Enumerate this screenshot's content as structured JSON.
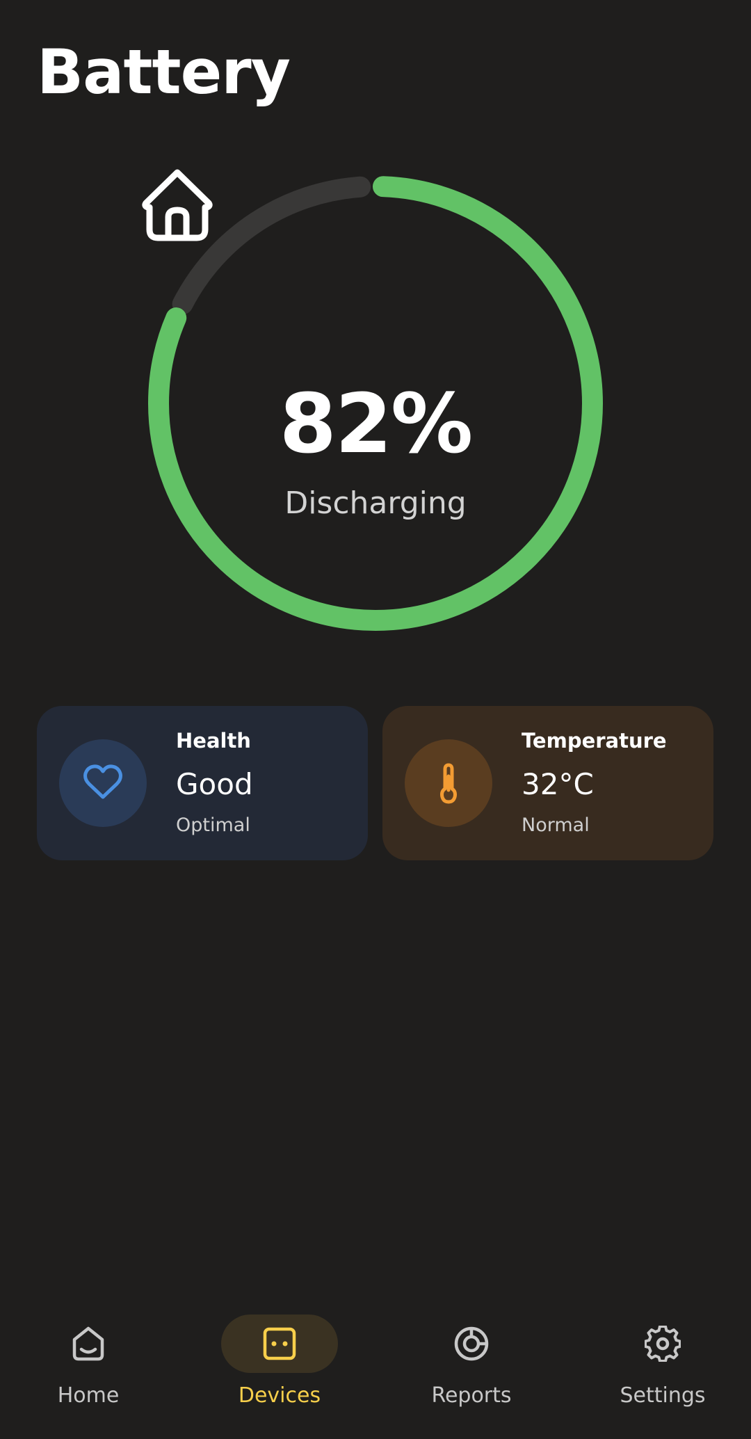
{
  "header": {
    "title": "Battery"
  },
  "battery": {
    "level_percent": 82,
    "level_label": "82%",
    "status": "Discharging",
    "icon": "home-icon",
    "colors": {
      "progress": "#62c266",
      "track": "#393837"
    }
  },
  "cards": {
    "health": {
      "label": "Health",
      "value": "Good",
      "sub": "Optimal",
      "icon": "heart-icon",
      "accent": "#4a90e2"
    },
    "temperature": {
      "label": "Temperature",
      "value": "32°C",
      "sub": "Normal",
      "icon": "thermometer-icon",
      "accent": "#f39c33"
    }
  },
  "nav": {
    "items": [
      {
        "label": "Home",
        "icon": "home-icon",
        "active": false
      },
      {
        "label": "Devices",
        "icon": "device-icon",
        "active": true
      },
      {
        "label": "Reports",
        "icon": "pie-chart-icon",
        "active": false
      },
      {
        "label": "Settings",
        "icon": "gear-icon",
        "active": false
      }
    ],
    "active_color": "#f7cf4b"
  }
}
